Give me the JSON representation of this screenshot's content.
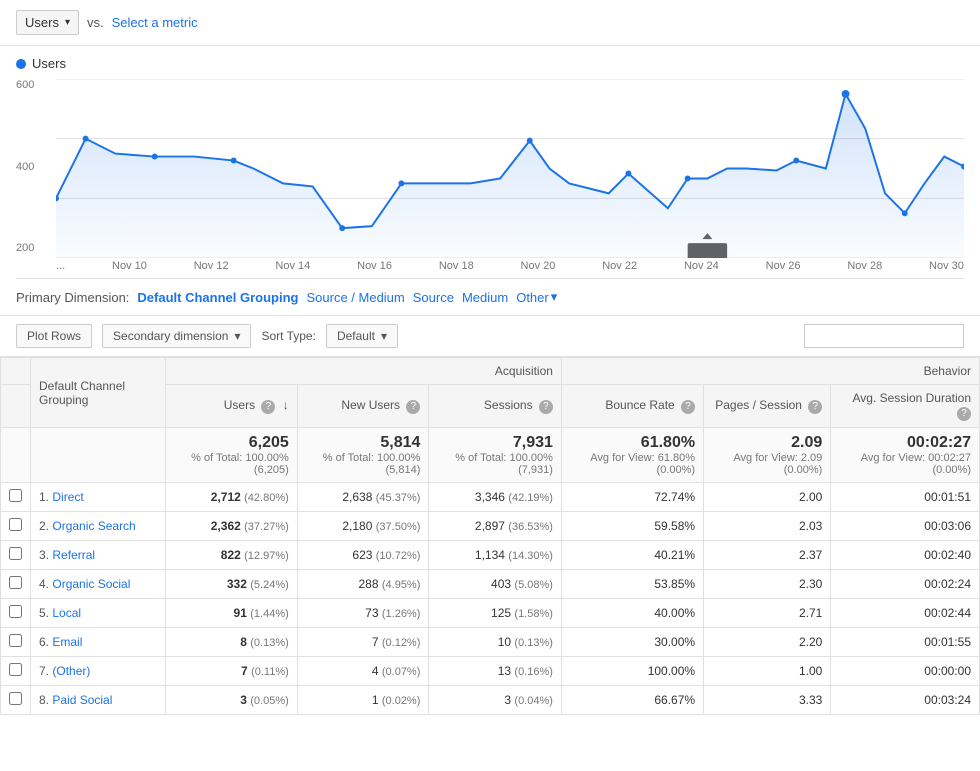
{
  "topbar": {
    "metric1": "Users",
    "vs": "vs.",
    "select_metric": "Select a metric"
  },
  "chart": {
    "legend_label": "Users",
    "y_axis": [
      "600",
      "400",
      "200"
    ],
    "x_labels": [
      "...",
      "Nov 10",
      "Nov 12",
      "Nov 14",
      "Nov 16",
      "Nov 18",
      "Nov 20",
      "Nov 22",
      "Nov 24",
      "Nov 26",
      "Nov 28",
      "Nov 30"
    ]
  },
  "primary_dimension": {
    "label": "Primary Dimension:",
    "current": "Default Channel Grouping",
    "links": [
      "Source / Medium",
      "Source",
      "Medium",
      "Other ▾"
    ]
  },
  "toolbar": {
    "plot_rows": "Plot Rows",
    "secondary_dimension": "Secondary dimension",
    "sort_type_label": "Sort Type:",
    "sort_default": "Default",
    "search_placeholder": ""
  },
  "table": {
    "col_dimension": "Default Channel Grouping",
    "acquisition_label": "Acquisition",
    "behavior_label": "Behavior",
    "cols": [
      "Users",
      "New Users",
      "Sessions",
      "Bounce Rate",
      "Pages / Session",
      "Avg. Session Duration"
    ],
    "totals": {
      "users": "6,205",
      "users_sub": "% of Total: 100.00% (6,205)",
      "new_users": "5,814",
      "new_users_sub": "% of Total: 100.00% (5,814)",
      "sessions": "7,931",
      "sessions_sub": "% of Total: 100.00% (7,931)",
      "bounce_rate": "61.80%",
      "bounce_rate_sub": "Avg for View: 61.80% (0.00%)",
      "pages_session": "2.09",
      "pages_session_sub": "Avg for View: 2.09 (0.00%)",
      "avg_duration": "00:02:27",
      "avg_duration_sub": "Avg for View: 00:02:27 (0.00%)"
    },
    "rows": [
      {
        "num": 1,
        "name": "Direct",
        "users": "2,712",
        "users_pct": "(42.80%)",
        "new_users": "2,638",
        "new_users_pct": "(45.37%)",
        "sessions": "3,346",
        "sessions_pct": "(42.19%)",
        "bounce_rate": "72.74%",
        "pages": "2.00",
        "duration": "00:01:51"
      },
      {
        "num": 2,
        "name": "Organic Search",
        "users": "2,362",
        "users_pct": "(37.27%)",
        "new_users": "2,180",
        "new_users_pct": "(37.50%)",
        "sessions": "2,897",
        "sessions_pct": "(36.53%)",
        "bounce_rate": "59.58%",
        "pages": "2.03",
        "duration": "00:03:06"
      },
      {
        "num": 3,
        "name": "Referral",
        "users": "822",
        "users_pct": "(12.97%)",
        "new_users": "623",
        "new_users_pct": "(10.72%)",
        "sessions": "1,134",
        "sessions_pct": "(14.30%)",
        "bounce_rate": "40.21%",
        "pages": "2.37",
        "duration": "00:02:40"
      },
      {
        "num": 4,
        "name": "Organic Social",
        "users": "332",
        "users_pct": "(5.24%)",
        "new_users": "288",
        "new_users_pct": "(4.95%)",
        "sessions": "403",
        "sessions_pct": "(5.08%)",
        "bounce_rate": "53.85%",
        "pages": "2.30",
        "duration": "00:02:24"
      },
      {
        "num": 5,
        "name": "Local",
        "users": "91",
        "users_pct": "(1.44%)",
        "new_users": "73",
        "new_users_pct": "(1.26%)",
        "sessions": "125",
        "sessions_pct": "(1.58%)",
        "bounce_rate": "40.00%",
        "pages": "2.71",
        "duration": "00:02:44"
      },
      {
        "num": 6,
        "name": "Email",
        "users": "8",
        "users_pct": "(0.13%)",
        "new_users": "7",
        "new_users_pct": "(0.12%)",
        "sessions": "10",
        "sessions_pct": "(0.13%)",
        "bounce_rate": "30.00%",
        "pages": "2.20",
        "duration": "00:01:55"
      },
      {
        "num": 7,
        "name": "(Other)",
        "users": "7",
        "users_pct": "(0.11%)",
        "new_users": "4",
        "new_users_pct": "(0.07%)",
        "sessions": "13",
        "sessions_pct": "(0.16%)",
        "bounce_rate": "100.00%",
        "pages": "1.00",
        "duration": "00:00:00"
      },
      {
        "num": 8,
        "name": "Paid Social",
        "users": "3",
        "users_pct": "(0.05%)",
        "new_users": "1",
        "new_users_pct": "(0.02%)",
        "sessions": "3",
        "sessions_pct": "(0.04%)",
        "bounce_rate": "66.67%",
        "pages": "3.33",
        "duration": "00:03:24"
      }
    ]
  }
}
